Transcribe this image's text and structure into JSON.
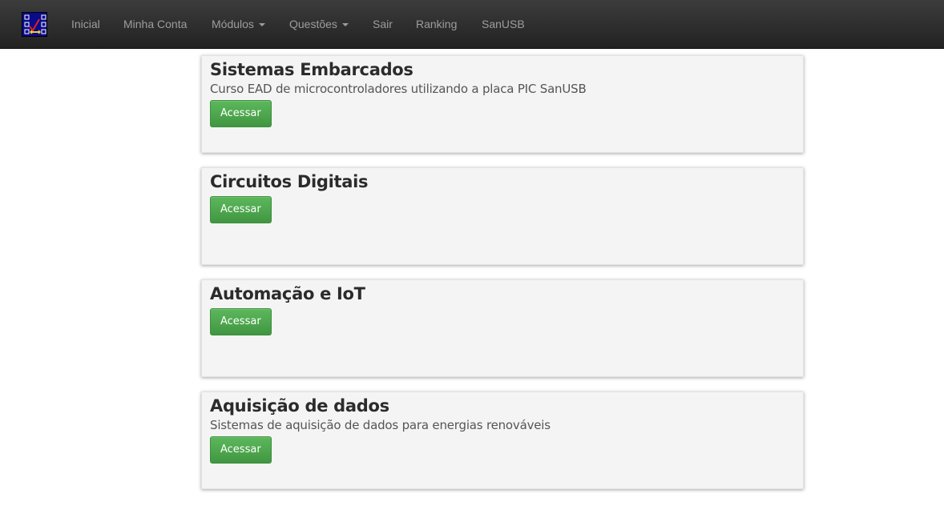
{
  "nav": {
    "items": [
      {
        "label": "Inicial"
      },
      {
        "label": "Minha Conta"
      },
      {
        "label": "Módulos"
      },
      {
        "label": "Questões"
      },
      {
        "label": "Sair"
      },
      {
        "label": "Ranking"
      },
      {
        "label": "SanUSB"
      }
    ]
  },
  "modules": [
    {
      "title": "Sistemas Embarcados",
      "description": "Curso EAD de microcontroladores utilizando a placa PIC SanUSB",
      "button": "Acessar"
    },
    {
      "title": "Circuitos Digitais",
      "description": "",
      "button": "Acessar"
    },
    {
      "title": "Automação e IoT",
      "description": "",
      "button": "Acessar"
    },
    {
      "title": "Aquisição de dados",
      "description": "Sistemas de aquisição de dados para energias renováveis",
      "button": "Acessar"
    }
  ],
  "colors": {
    "navbar": "#222222",
    "nav_text": "#9d9d9d",
    "button_green": "#5cb85c",
    "card_bg": "#f4f4f4"
  }
}
